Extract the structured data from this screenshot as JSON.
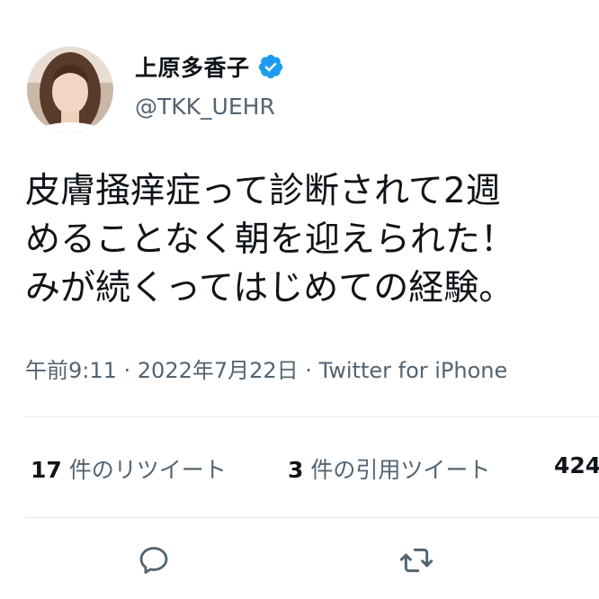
{
  "user": {
    "display_name": "上原多香子",
    "handle": "@TKK_UEHR",
    "verified_icon": "verified-badge-icon",
    "avatar_icon": "avatar-photo"
  },
  "tweet": {
    "lines": [
      "皮膚掻痒症って診断されて2週",
      "めることなく朝を迎えられた！",
      "みが続くってはじめての経験。"
    ]
  },
  "meta": {
    "text": "午前9:11 · 2022年7月22日 · Twitter for iPhone"
  },
  "stats": {
    "retweets_count": "17",
    "retweets_label": "件のリツイート",
    "quotes_count": "3",
    "quotes_label": "件の引用ツイート",
    "likes_count": "424"
  },
  "actions": {
    "reply_icon": "reply-icon",
    "retweet_icon": "retweet-icon"
  },
  "colors": {
    "text": "#0f1419",
    "secondary": "#536471",
    "verified": "#1d9bf0",
    "divider": "#e6ecf0"
  }
}
